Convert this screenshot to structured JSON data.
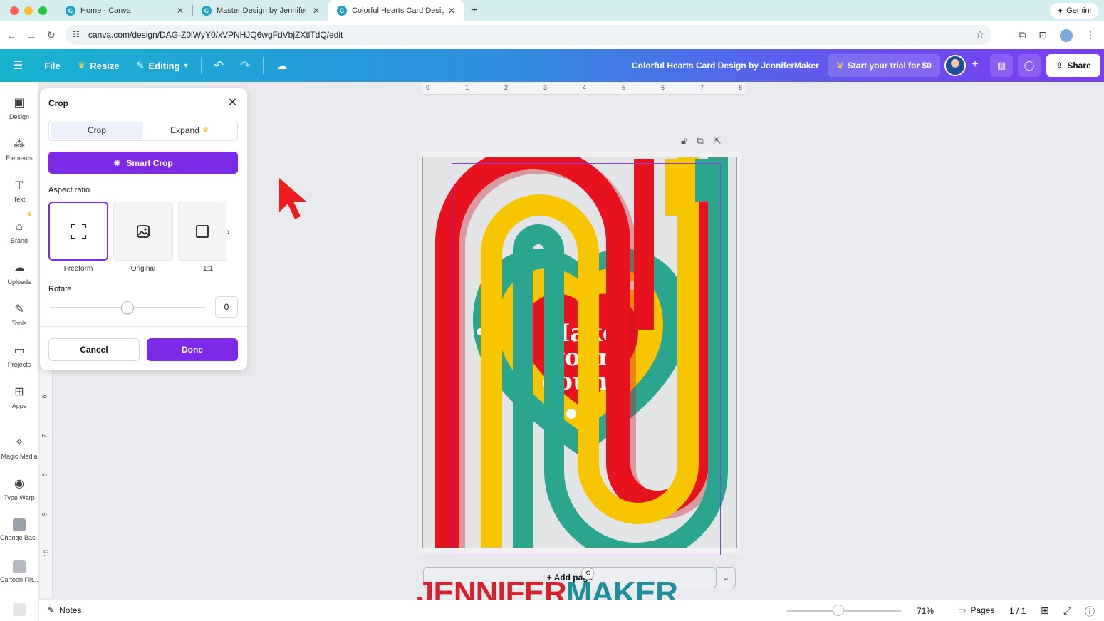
{
  "browser": {
    "tabs": [
      {
        "title": "Home - Canva",
        "active": false
      },
      {
        "title": "Master Design by JenniferMaker",
        "active": false
      },
      {
        "title": "Colorful Hearts Card Design by JenniferMaker",
        "active": true
      }
    ],
    "new_tab": "+",
    "gemini_label": "Gemini",
    "url": "canva.com/design/DAG-Z0lWyY0/xVPNHJQ6wgFdVbjZXtlTdQ/edit"
  },
  "header": {
    "file_label": "File",
    "resize_label": "Resize",
    "editing_label": "Editing",
    "doc_title": "Colorful Hearts Card Design by JenniferMaker",
    "trial_label": "Start your trial for $0",
    "share_label": "Share"
  },
  "rail": {
    "items": [
      {
        "label": "Design",
        "icon": "design-icon"
      },
      {
        "label": "Elements",
        "icon": "elements-icon"
      },
      {
        "label": "Text",
        "icon": "text-icon"
      },
      {
        "label": "Brand",
        "icon": "brand-icon"
      },
      {
        "label": "Uploads",
        "icon": "uploads-icon"
      },
      {
        "label": "Tools",
        "icon": "tools-icon"
      },
      {
        "label": "Projects",
        "icon": "projects-icon"
      },
      {
        "label": "Apps",
        "icon": "apps-icon"
      },
      {
        "label": "Magic Media",
        "icon": "magic-media-icon"
      },
      {
        "label": "Type Warp",
        "icon": "type-warp-icon"
      },
      {
        "label": "Change Bac...",
        "icon": "change-background-icon"
      },
      {
        "label": "Cartoon Filt...",
        "icon": "cartoon-filter-icon"
      }
    ]
  },
  "crop_panel": {
    "title": "Crop",
    "tabs": {
      "crop": "Crop",
      "expand": "Expand"
    },
    "smart_crop_label": "Smart Crop",
    "aspect_ratio_label": "Aspect ratio",
    "aspect_options": [
      {
        "label": "Freeform",
        "selected": true
      },
      {
        "label": "Original",
        "selected": false
      },
      {
        "label": "1:1",
        "selected": false
      }
    ],
    "rotate_label": "Rotate",
    "rotate_value": "0",
    "rotate_fraction": 0.5,
    "cancel_label": "Cancel",
    "done_label": "Done"
  },
  "ruler": {
    "top_ticks": [
      "0",
      "1",
      "2",
      "3",
      "4",
      "5",
      "6",
      "7",
      "8"
    ],
    "left_ticks": [
      "6",
      "7",
      "8",
      "9",
      "10"
    ]
  },
  "canvas": {
    "add_page_label": "+ Add page",
    "card_text": [
      "Make",
      "your",
      "count"
    ]
  },
  "watermark": {
    "part1": "JENNIFER",
    "part2": "MAKER"
  },
  "bottombar": {
    "notes_label": "Notes",
    "zoom_value": "71%",
    "zoom_fraction": 0.45,
    "pages_label": "Pages",
    "page_count": "1 / 1"
  },
  "colors": {
    "accent": "#7d2ae8",
    "rainbow_red": "#e8121f",
    "rainbow_yellow": "#f7c600",
    "rainbow_teal": "#2aa68e",
    "cursor_red": "#ee1c1c"
  }
}
